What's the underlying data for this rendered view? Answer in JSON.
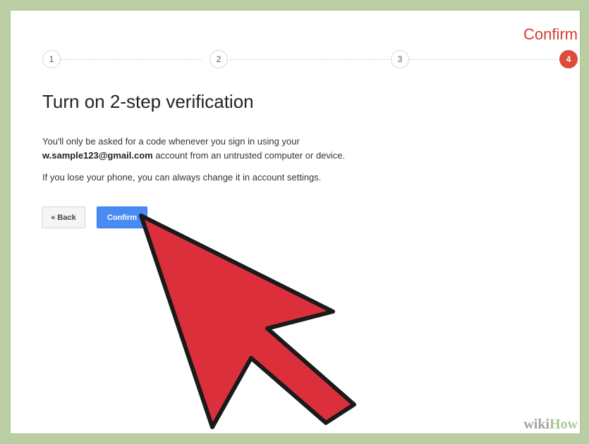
{
  "header": {
    "step_label": "Confirm"
  },
  "progress": {
    "steps": [
      "1",
      "2",
      "3",
      "4"
    ],
    "active_step": 4
  },
  "content": {
    "title": "Turn on 2-step verification",
    "line1_prefix": "You'll only be asked for a code whenever you sign in using your",
    "email": "w.sample123@gmail.com",
    "line2_suffix": " account from an untrusted computer or device.",
    "line3": "If you lose your phone, you can always change it in account settings."
  },
  "buttons": {
    "back_label": "« Back",
    "confirm_label": "Confirm"
  },
  "watermark": {
    "part1": "wiki",
    "part2": "How"
  },
  "colors": {
    "accent_red": "#dd4b39",
    "confirm_blue": "#4a8af4",
    "arrow_red": "#dc2f3c",
    "frame_green": "#b9cfa3"
  },
  "icons": {
    "cursor": "big-red-arrow-cursor-icon"
  }
}
